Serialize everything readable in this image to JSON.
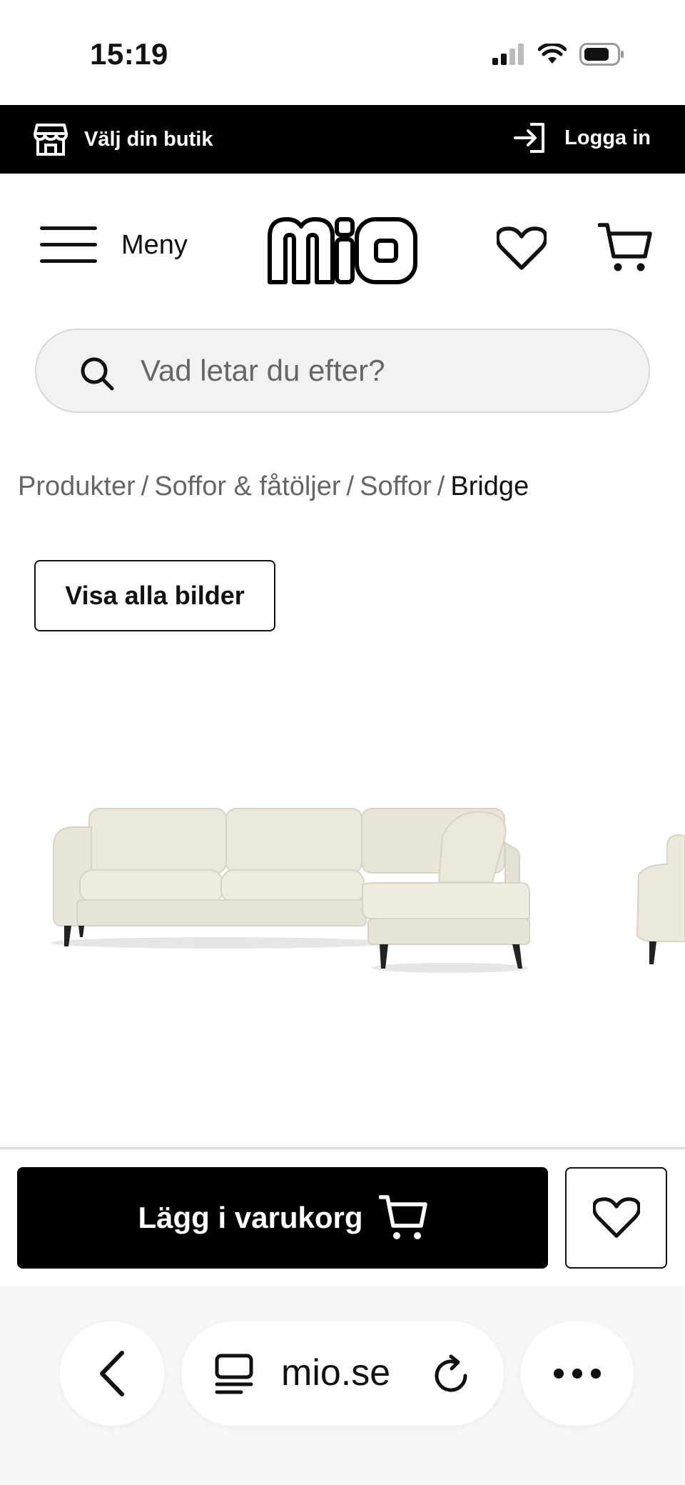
{
  "status_bar": {
    "time": "15:19",
    "icons": [
      "cellular-signal-icon",
      "wifi-icon",
      "battery-icon"
    ]
  },
  "store_bar": {
    "store_label": "Välj din butik",
    "store_icon": "store-icon",
    "login_label": "Logga in",
    "login_icon": "login-icon"
  },
  "header": {
    "menu_label": "Meny",
    "menu_icon": "hamburger-icon",
    "logo_text": "MIO",
    "wishlist_icon": "heart-icon",
    "cart_icon": "cart-icon"
  },
  "search": {
    "placeholder": "Vad letar du efter?",
    "value": ""
  },
  "breadcrumb": {
    "items": [
      "Produkter",
      "Soffor & fåtöljer",
      "Soffor"
    ],
    "separator": "/",
    "current": "Bridge"
  },
  "gallery": {
    "show_all_label": "Visa alla bilder",
    "product_name": "Bridge",
    "sofa_color": "#ece8dc"
  },
  "buy_bar": {
    "add_to_cart_label": "Lägg i varukorg",
    "favorite_icon": "heart-icon"
  },
  "browser": {
    "url": "mio.se",
    "back_icon": "chevron-left-icon",
    "tabs_icon": "tabs-icon",
    "reload_icon": "reload-icon",
    "more_icon": "more-dots-icon"
  },
  "colors": {
    "accent": "#000000",
    "background": "#ffffff",
    "search_bg": "#f2f2f2",
    "muted_text": "#666666"
  }
}
